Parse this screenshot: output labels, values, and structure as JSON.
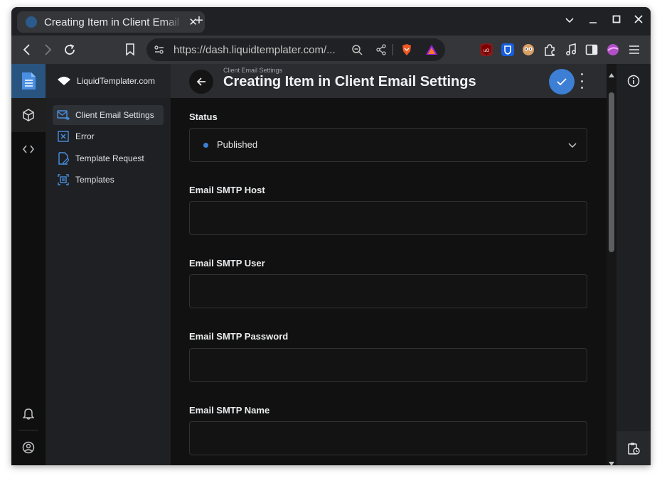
{
  "browser": {
    "tab_title": "Creating Item in Client Email Settings",
    "tab_close": "✕",
    "new_tab": "+",
    "url": "https://dash.liquidtemplater.com/...",
    "window_controls": {
      "minimize": "–",
      "maximize": "☐",
      "close": "✕"
    }
  },
  "app": {
    "brand": "LiquidTemplater.com",
    "accent_color": "#3d7fd4",
    "nav_items": [
      {
        "label": "Client Email Settings",
        "icon": "mail-forward-icon",
        "active": true
      },
      {
        "label": "Error",
        "icon": "error-box-icon",
        "active": false
      },
      {
        "label": "Template Request",
        "icon": "document-edit-icon",
        "active": false
      },
      {
        "label": "Templates",
        "icon": "template-frame-icon",
        "active": false
      }
    ],
    "rail_icons": [
      "logo-document-icon",
      "cube-icon",
      "code-icon",
      "bell-icon",
      "account-circle-icon"
    ],
    "header": {
      "breadcrumb": "Client Email Settings",
      "title": "Creating Item in Client Email Settings"
    },
    "form": {
      "status_label": "Status",
      "status_value": "Published",
      "fields": [
        {
          "label": "Email SMTP Host",
          "value": ""
        },
        {
          "label": "Email SMTP User",
          "value": ""
        },
        {
          "label": "Email SMTP Password",
          "value": ""
        },
        {
          "label": "Email SMTP Name",
          "value": ""
        }
      ]
    }
  }
}
